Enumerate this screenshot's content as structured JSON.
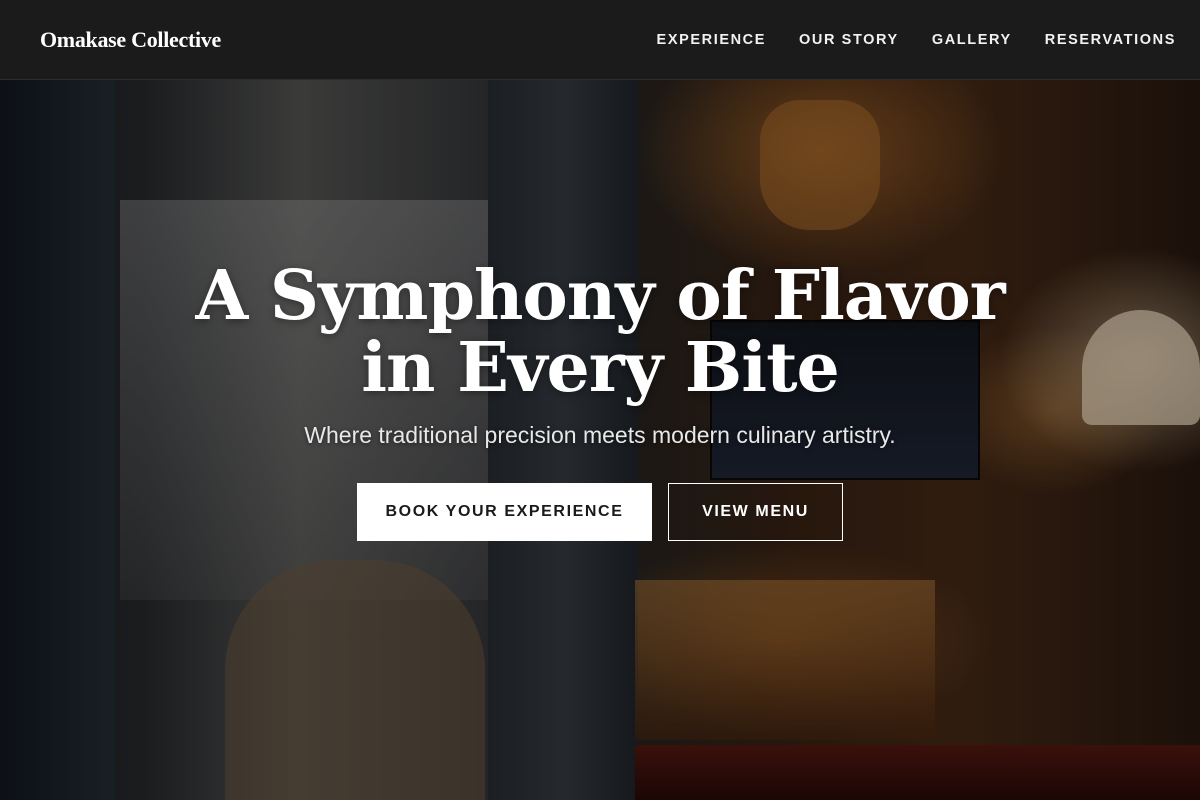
{
  "header": {
    "brand": "Omakase Collective",
    "nav": [
      {
        "label": "EXPERIENCE"
      },
      {
        "label": "OUR STORY"
      },
      {
        "label": "GALLERY"
      },
      {
        "label": "RESERVATIONS"
      }
    ]
  },
  "hero": {
    "headline": "A Symphony of Flavor in Every Bite",
    "subheadline": "Where traditional precision meets modern culinary artistry.",
    "primary_cta": "BOOK YOUR EXPERIENCE",
    "secondary_cta": "VIEW MENU"
  },
  "colors": {
    "nav_background": "#1b1b1b",
    "primary_button": "#ffffff",
    "text": "#ffffff"
  }
}
